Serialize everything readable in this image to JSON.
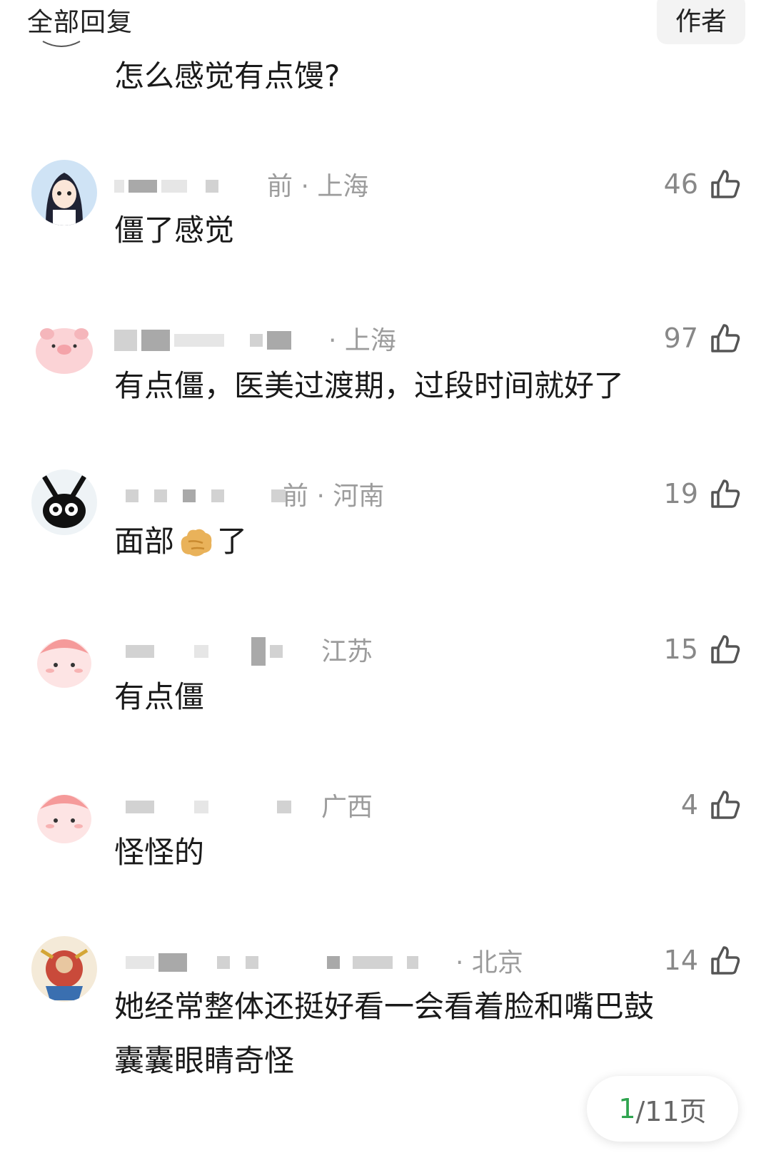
{
  "header": {
    "title": "全部回复",
    "author_label": "作者"
  },
  "top_reply": {
    "text": "怎么感觉有点馒?"
  },
  "replies": [
    {
      "meta": "前 · 上海",
      "likes": "46",
      "text": [
        "僵了感觉"
      ]
    },
    {
      "meta": "· 上海",
      "likes": "97",
      "text": [
        "有点僵，医美过渡期，过段时间就好了"
      ]
    },
    {
      "meta": "前 · 河南",
      "likes": "19",
      "text": [
        "面部",
        "了"
      ],
      "emoji": "ginger"
    },
    {
      "meta": "江苏",
      "likes": "15",
      "text": [
        "有点僵"
      ]
    },
    {
      "meta": "广西",
      "likes": "4",
      "text": [
        "怪怪的"
      ]
    },
    {
      "meta": "· 北京",
      "likes": "14",
      "text": [
        "她经常整体还挺好看一会看着脸和嘴巴鼓",
        "囊囊眼睛奇怪"
      ]
    }
  ],
  "pager": {
    "current": "1",
    "total": "/11页"
  },
  "icons": {
    "like": "thumbs-up-icon"
  },
  "colors": {
    "pager_current": "#2fa44f",
    "meta": "#9c9c9c"
  }
}
